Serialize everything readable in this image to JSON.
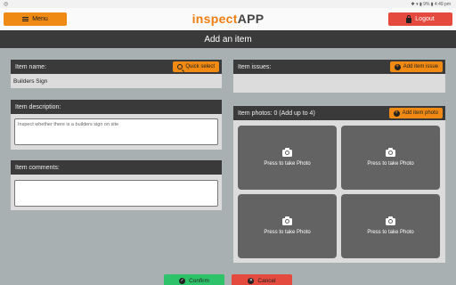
{
  "status_bar": {
    "left": "◎",
    "right": "✱ ▾ ▮ 9% ▮ 4:49 pm"
  },
  "header": {
    "menu_label": "Menu",
    "brand_part1": "inspect",
    "brand_part2": "APP",
    "logout_label": "Logout"
  },
  "title": "Add an item",
  "item_name": {
    "label": "Item name:",
    "quick_select_label": "Quick select",
    "value": "Builders Sign"
  },
  "item_description": {
    "label": "Item description:",
    "value": "Inspect whether there is a builders sign on site"
  },
  "item_comments": {
    "label": "Item comments:",
    "value": ""
  },
  "item_issues": {
    "label": "Item issues:",
    "add_label": "Add item issue"
  },
  "item_photos": {
    "label": "Item photos: 0 (Add up to 4)",
    "add_label": "Add item photo",
    "slots": [
      "Press to take Photo",
      "Press to take Photo",
      "Press to take Photo",
      "Press to take Photo"
    ]
  },
  "footer": {
    "confirm_label": "Confirm",
    "cancel_label": "Cancel"
  },
  "colors": {
    "accent": "#ef8a14",
    "danger": "#e44a3e",
    "success": "#2ec36a",
    "bar": "#3a3a3a",
    "background": "#a9b0b2"
  },
  "icons": [
    "menu-icon",
    "lock-icon",
    "search-icon",
    "plus-circle-icon",
    "camera-icon",
    "check-circle-icon",
    "x-circle-icon"
  ]
}
